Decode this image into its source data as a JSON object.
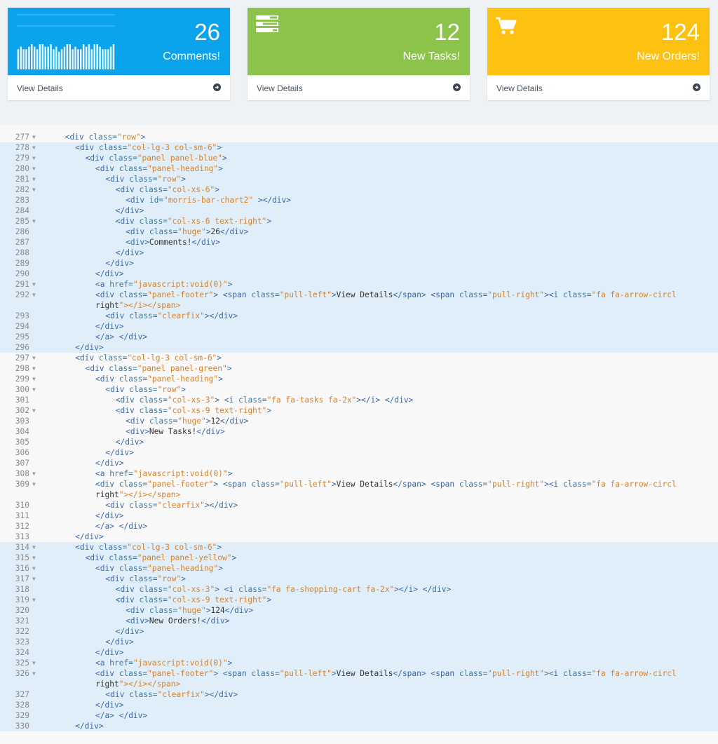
{
  "panels": [
    {
      "value": "26",
      "label": "Comments!",
      "footer": "View Details",
      "color": "#0aa3ec",
      "icon": "bar-chart-sparkline-icon",
      "chart_data": {
        "type": "bar",
        "values": [
          8,
          9,
          8,
          8,
          9,
          10,
          9,
          8,
          10,
          10,
          9,
          9,
          10,
          8,
          9,
          7,
          8,
          9,
          10,
          10,
          8,
          9,
          8,
          8,
          10,
          9,
          10,
          8,
          10,
          10,
          9,
          8,
          8,
          8,
          9,
          10
        ]
      }
    },
    {
      "value": "12",
      "label": "New Tasks!",
      "footer": "View Details",
      "color": "#8cc34b",
      "icon": "tasks-icon"
    },
    {
      "value": "124",
      "label": "New Orders!",
      "footer": "View Details",
      "color": "#fdc111",
      "icon": "shopping-cart-icon"
    }
  ],
  "code_lines": [
    {
      "n": "277",
      "fold": true,
      "hl": false,
      "ind": 2,
      "t": "<div class=\"row\">"
    },
    {
      "n": "278",
      "fold": true,
      "hl": true,
      "ind": 3,
      "t": "<div class=\"col-lg-3 col-sm-6\">"
    },
    {
      "n": "279",
      "fold": true,
      "hl": true,
      "ind": 4,
      "t": "<div class=\"panel panel-blue\">"
    },
    {
      "n": "280",
      "fold": true,
      "hl": true,
      "ind": 5,
      "t": "<div class=\"panel-heading\">"
    },
    {
      "n": "281",
      "fold": true,
      "hl": true,
      "ind": 6,
      "t": "<div class=\"row\">"
    },
    {
      "n": "282",
      "fold": true,
      "hl": true,
      "ind": 7,
      "t": "<div class=\"col-xs-6\">"
    },
    {
      "n": "283",
      "fold": false,
      "hl": true,
      "ind": 8,
      "t": "<div id=\"morris-bar-chart2\" ></div>"
    },
    {
      "n": "284",
      "fold": false,
      "hl": true,
      "ind": 7,
      "t": "</div>"
    },
    {
      "n": "285",
      "fold": true,
      "hl": true,
      "ind": 7,
      "t": "<div class=\"col-xs-6 text-right\">"
    },
    {
      "n": "286",
      "fold": false,
      "hl": true,
      "ind": 8,
      "t": "<div class=\"huge\">26</div>"
    },
    {
      "n": "287",
      "fold": false,
      "hl": true,
      "ind": 8,
      "t": "<div>Comments!</div>"
    },
    {
      "n": "288",
      "fold": false,
      "hl": true,
      "ind": 7,
      "t": "</div>"
    },
    {
      "n": "289",
      "fold": false,
      "hl": true,
      "ind": 6,
      "t": "</div>"
    },
    {
      "n": "290",
      "fold": false,
      "hl": true,
      "ind": 5,
      "t": "</div>"
    },
    {
      "n": "291",
      "fold": true,
      "hl": true,
      "ind": 5,
      "t": "<a href=\"javascript:void(0)\">"
    },
    {
      "n": "292",
      "fold": true,
      "hl": true,
      "ind": 5,
      "t": "<div class=\"panel-footer\"> <span class=\"pull-left\">View Details</span> <span class=\"pull-right\"><i class=\"fa fa-arrow-circl"
    },
    {
      "n": "",
      "fold": false,
      "hl": true,
      "ind": 5,
      "t": "right\"></i></span>"
    },
    {
      "n": "293",
      "fold": false,
      "hl": true,
      "ind": 6,
      "t": "<div class=\"clearfix\"></div>"
    },
    {
      "n": "294",
      "fold": false,
      "hl": true,
      "ind": 5,
      "t": "</div>"
    },
    {
      "n": "295",
      "fold": false,
      "hl": true,
      "ind": 5,
      "t": "</a> </div>"
    },
    {
      "n": "296",
      "fold": false,
      "hl": true,
      "ind": 3,
      "t": "</div>"
    },
    {
      "n": "297",
      "fold": true,
      "hl": false,
      "ind": 3,
      "t": "<div class=\"col-lg-3 col-sm-6\">"
    },
    {
      "n": "298",
      "fold": true,
      "hl": false,
      "ind": 4,
      "t": "<div class=\"panel panel-green\">"
    },
    {
      "n": "299",
      "fold": true,
      "hl": false,
      "ind": 5,
      "t": "<div class=\"panel-heading\">"
    },
    {
      "n": "300",
      "fold": true,
      "hl": false,
      "ind": 6,
      "t": "<div class=\"row\">"
    },
    {
      "n": "301",
      "fold": false,
      "hl": false,
      "ind": 7,
      "t": "<div class=\"col-xs-3\"> <i class=\"fa fa-tasks fa-2x\"></i> </div>"
    },
    {
      "n": "302",
      "fold": true,
      "hl": false,
      "ind": 7,
      "t": "<div class=\"col-xs-9 text-right\">"
    },
    {
      "n": "303",
      "fold": false,
      "hl": false,
      "ind": 8,
      "t": "<div class=\"huge\">12</div>"
    },
    {
      "n": "304",
      "fold": false,
      "hl": false,
      "ind": 8,
      "t": "<div>New Tasks!</div>"
    },
    {
      "n": "305",
      "fold": false,
      "hl": false,
      "ind": 7,
      "t": "</div>"
    },
    {
      "n": "306",
      "fold": false,
      "hl": false,
      "ind": 6,
      "t": "</div>"
    },
    {
      "n": "307",
      "fold": false,
      "hl": false,
      "ind": 5,
      "t": "</div>"
    },
    {
      "n": "308",
      "fold": true,
      "hl": false,
      "ind": 5,
      "t": "<a href=\"javascript:void(0)\">"
    },
    {
      "n": "309",
      "fold": true,
      "hl": false,
      "ind": 5,
      "t": "<div class=\"panel-footer\"> <span class=\"pull-left\">View Details</span> <span class=\"pull-right\"><i class=\"fa fa-arrow-circl"
    },
    {
      "n": "",
      "fold": false,
      "hl": false,
      "ind": 5,
      "t": "right\"></i></span>"
    },
    {
      "n": "310",
      "fold": false,
      "hl": false,
      "ind": 6,
      "t": "<div class=\"clearfix\"></div>"
    },
    {
      "n": "311",
      "fold": false,
      "hl": false,
      "ind": 5,
      "t": "</div>"
    },
    {
      "n": "312",
      "fold": false,
      "hl": false,
      "ind": 5,
      "t": "</a> </div>"
    },
    {
      "n": "313",
      "fold": false,
      "hl": false,
      "ind": 3,
      "t": "</div>"
    },
    {
      "n": "314",
      "fold": true,
      "hl": true,
      "ind": 3,
      "t": "<div class=\"col-lg-3 col-sm-6\">"
    },
    {
      "n": "315",
      "fold": true,
      "hl": true,
      "ind": 4,
      "t": "<div class=\"panel panel-yellow\">"
    },
    {
      "n": "316",
      "fold": true,
      "hl": true,
      "ind": 5,
      "t": "<div class=\"panel-heading\">"
    },
    {
      "n": "317",
      "fold": true,
      "hl": true,
      "ind": 6,
      "t": "<div class=\"row\">"
    },
    {
      "n": "318",
      "fold": false,
      "hl": true,
      "ind": 7,
      "t": "<div class=\"col-xs-3\"> <i class=\"fa fa-shopping-cart fa-2x\"></i> </div>"
    },
    {
      "n": "319",
      "fold": true,
      "hl": true,
      "ind": 7,
      "t": "<div class=\"col-xs-9 text-right\">"
    },
    {
      "n": "320",
      "fold": false,
      "hl": true,
      "ind": 8,
      "t": "<div class=\"huge\">124</div>"
    },
    {
      "n": "321",
      "fold": false,
      "hl": true,
      "ind": 8,
      "t": "<div>New Orders!</div>"
    },
    {
      "n": "322",
      "fold": false,
      "hl": true,
      "ind": 7,
      "t": "</div>"
    },
    {
      "n": "323",
      "fold": false,
      "hl": true,
      "ind": 6,
      "t": "</div>"
    },
    {
      "n": "324",
      "fold": false,
      "hl": true,
      "ind": 5,
      "t": "</div>"
    },
    {
      "n": "325",
      "fold": true,
      "hl": true,
      "ind": 5,
      "t": "<a href=\"javascript:void(0)\">"
    },
    {
      "n": "326",
      "fold": true,
      "hl": true,
      "ind": 5,
      "t": "<div class=\"panel-footer\"> <span class=\"pull-left\">View Details</span> <span class=\"pull-right\"><i class=\"fa fa-arrow-circl"
    },
    {
      "n": "",
      "fold": false,
      "hl": true,
      "ind": 5,
      "t": "right\"></i></span>"
    },
    {
      "n": "327",
      "fold": false,
      "hl": true,
      "ind": 6,
      "t": "<div class=\"clearfix\"></div>"
    },
    {
      "n": "328",
      "fold": false,
      "hl": true,
      "ind": 5,
      "t": "</div>"
    },
    {
      "n": "329",
      "fold": false,
      "hl": true,
      "ind": 5,
      "t": "</a> </div>"
    },
    {
      "n": "330",
      "fold": false,
      "hl": true,
      "ind": 3,
      "t": "</div>"
    }
  ]
}
